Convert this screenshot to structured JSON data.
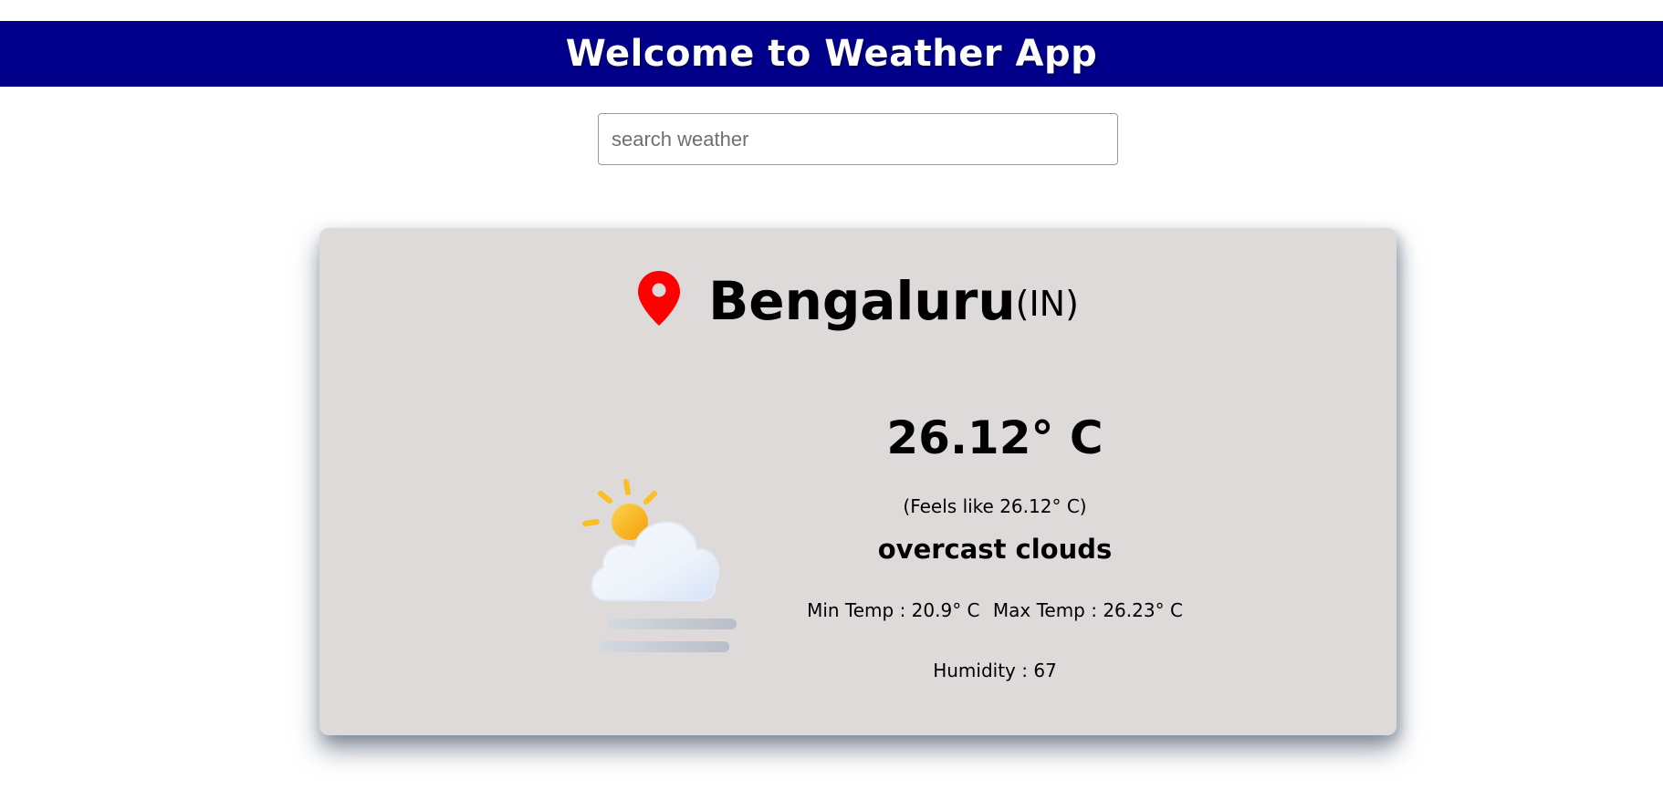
{
  "header": {
    "title": "Welcome to Weather App"
  },
  "search": {
    "placeholder": "search weather",
    "value": ""
  },
  "weather": {
    "city": "Bengaluru",
    "country": "(IN)",
    "temperature": "26.12° C",
    "feels_like": "(Feels like 26.12° C)",
    "description": "overcast clouds",
    "min_temp": "Min Temp : 20.9° C",
    "max_temp": "Max Temp : 26.23° C",
    "humidity": "Humidity : 67",
    "icon": "partly-cloudy-fog-icon"
  },
  "colors": {
    "header_bg": "#00008b",
    "card_bg": "#dedad9",
    "pin": "#ff0000",
    "sun": "#fbbf24"
  }
}
